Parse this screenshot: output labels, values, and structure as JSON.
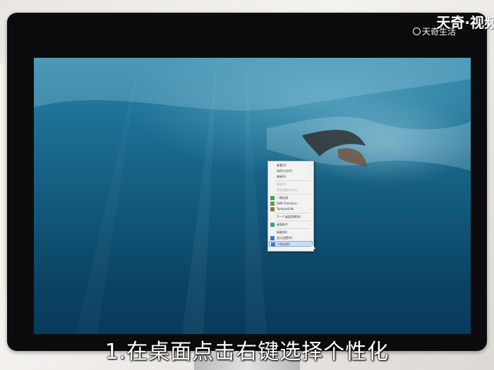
{
  "subtitle": "1.在桌面点击右键选择个性化",
  "watermark": {
    "top": "天奇·视频",
    "bottom": "天奇生活",
    "icon": "tianqi-logo-icon"
  },
  "context_menu": {
    "items": [
      {
        "label": "查看(V)",
        "submenu": true
      },
      {
        "label": "排序方式(O)",
        "submenu": true
      },
      {
        "label": "刷新(E)"
      },
      {
        "separator": true
      },
      {
        "label": "粘贴(P)",
        "disabled": true
      },
      {
        "label": "粘贴快捷方式(S)",
        "disabled": true
      },
      {
        "separator": true
      },
      {
        "label": "一键加速",
        "icon": "boost-icon",
        "icon_color": "#49a34a"
      },
      {
        "label": "SVN Checkout...",
        "icon": "svn-checkout-icon",
        "icon_color": "#6a9a3c"
      },
      {
        "label": "TortoiseSVN",
        "icon": "tortoisesvn-icon",
        "icon_color": "#8a7a4a",
        "submenu": true
      },
      {
        "separator": true
      },
      {
        "label": "下一个桌面背景(N)"
      },
      {
        "separator": true
      },
      {
        "label": "桌面助手",
        "icon": "desktop-assistant-icon",
        "icon_color": "#38a56a",
        "submenu": true
      },
      {
        "separator": true
      },
      {
        "label": "新建(W)",
        "submenu": true
      },
      {
        "label": "显示设置(D)",
        "icon": "display-settings-icon",
        "icon_color": "#3478c8"
      },
      {
        "label": "个性化(R)",
        "icon": "personalize-icon",
        "icon_color": "#3b82c4",
        "highlighted": true
      }
    ]
  },
  "colors": {
    "menu_highlight": "#c9defa",
    "screen_water": "#12587a"
  }
}
